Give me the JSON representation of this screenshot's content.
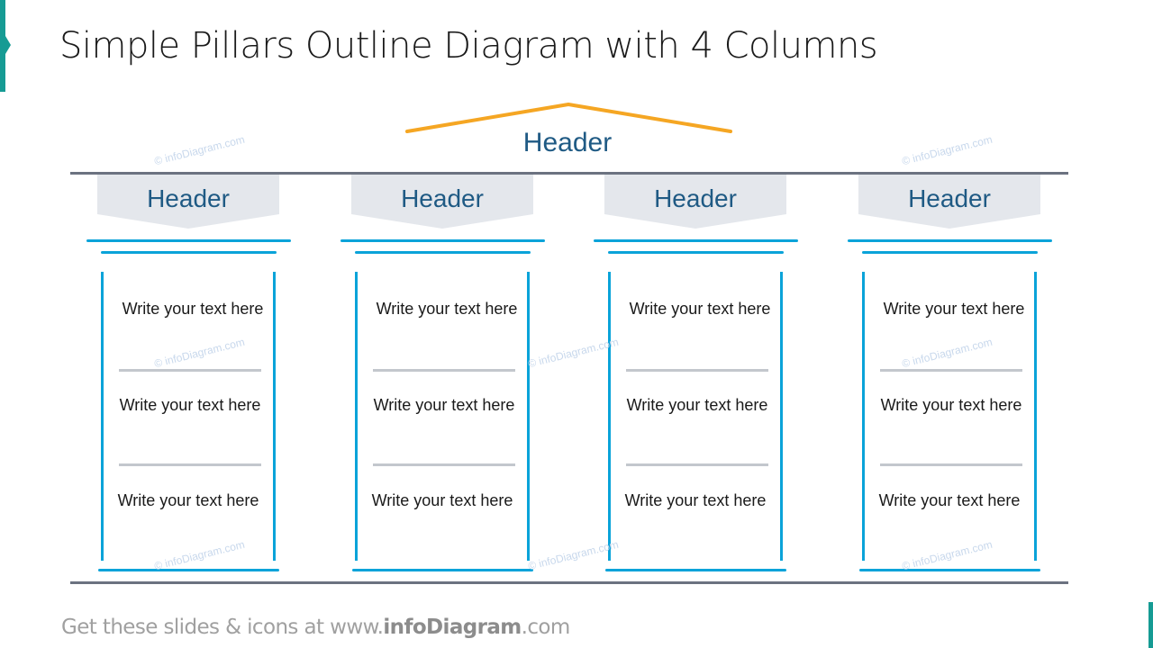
{
  "title": "Simple Pillars Outline Diagram with 4 Columns",
  "main_header": "Header",
  "colors": {
    "accent": "#169b94",
    "roof": "#f5a623",
    "pillar": "#0aa3d9",
    "header_text": "#1f5a84",
    "header_fill": "#e4e7ec",
    "line": "#6b7280",
    "separator": "#c3c7cd"
  },
  "columns": [
    {
      "header": "Header",
      "cells": [
        "Write your text here",
        "Write your text here",
        "Write your text here"
      ]
    },
    {
      "header": "Header",
      "cells": [
        "Write your text here",
        "Write your text here",
        "Write your text here"
      ]
    },
    {
      "header": "Header",
      "cells": [
        "Write your text here",
        "Write your text here",
        "Write your text here"
      ]
    },
    {
      "header": "Header",
      "cells": [
        "Write your text here",
        "Write your text here",
        "Write your text here"
      ]
    }
  ],
  "watermark": "© infoDiagram.com",
  "footer": {
    "prefix": "Get these slides & icons at www.",
    "brand": "infoDiagram",
    "suffix": ".com"
  }
}
